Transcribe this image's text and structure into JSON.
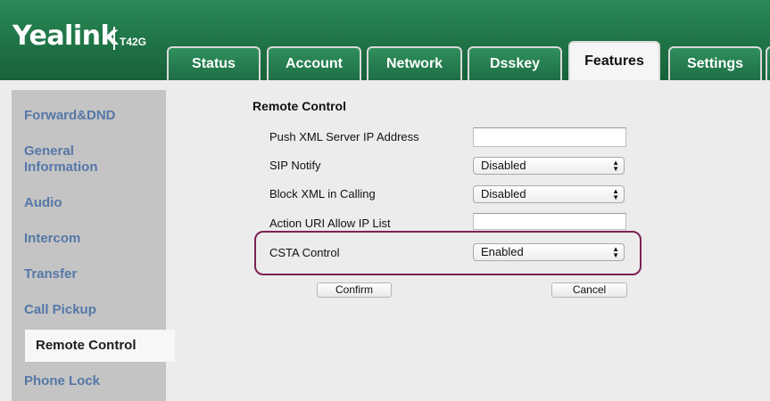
{
  "brand": {
    "logo": "Yealink",
    "model": "T42G"
  },
  "tabs": [
    {
      "label": "Status"
    },
    {
      "label": "Account"
    },
    {
      "label": "Network"
    },
    {
      "label": "Dsskey"
    },
    {
      "label": "Features",
      "active": true
    },
    {
      "label": "Settings"
    }
  ],
  "sidebar": {
    "items": [
      {
        "label": "Forward&DND"
      },
      {
        "label": "General Information"
      },
      {
        "label": "Audio"
      },
      {
        "label": "Intercom"
      },
      {
        "label": "Transfer"
      },
      {
        "label": "Call Pickup"
      },
      {
        "label": "Remote Control",
        "active": true
      },
      {
        "label": "Phone Lock"
      }
    ]
  },
  "form": {
    "title": "Remote Control",
    "push_xml": {
      "label": "Push XML Server IP Address",
      "value": ""
    },
    "sip_notify": {
      "label": "SIP Notify",
      "value": "Disabled"
    },
    "block_xml": {
      "label": "Block XML in Calling",
      "value": "Disabled"
    },
    "action_uri": {
      "label": "Action URI Allow IP List",
      "value": ""
    },
    "csta": {
      "label": "CSTA Control",
      "value": "Enabled"
    },
    "confirm_label": "Confirm",
    "cancel_label": "Cancel"
  },
  "colors": {
    "header_green": "#1f7346",
    "sidebar_text": "#5577a8",
    "highlight_border": "#7c2255"
  }
}
